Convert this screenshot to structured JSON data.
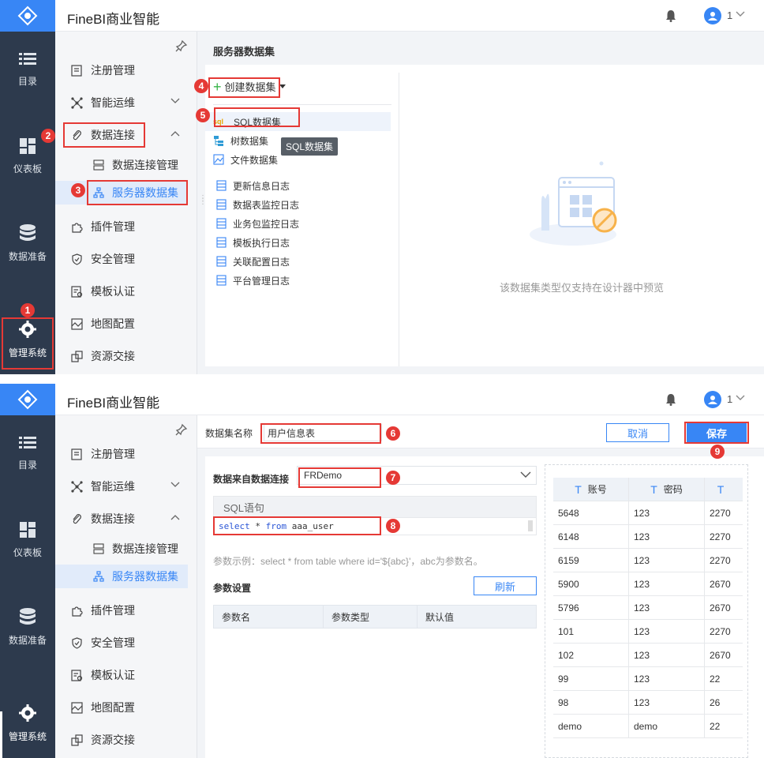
{
  "app": {
    "title": "FineBI商业智能",
    "user": "1"
  },
  "dark_nav": [
    {
      "label": "目录",
      "icon": "list-icon"
    },
    {
      "label": "仪表板",
      "icon": "dashboard-icon"
    },
    {
      "label": "数据准备",
      "icon": "database-icon"
    },
    {
      "label": "管理系统",
      "icon": "gear-icon"
    }
  ],
  "submenu": {
    "items": [
      {
        "label": "注册管理"
      },
      {
        "label": "智能运维"
      },
      {
        "label": "数据连接"
      },
      {
        "label": "数据连接管理"
      },
      {
        "label": "服务器数据集"
      },
      {
        "label": "插件管理"
      },
      {
        "label": "安全管理"
      },
      {
        "label": "模板认证"
      },
      {
        "label": "地图配置"
      },
      {
        "label": "资源交接"
      }
    ]
  },
  "panel1": {
    "title": "服务器数据集",
    "create_label": "创建数据集",
    "dropdown": [
      {
        "label": "SQL数据集",
        "icon": "sql"
      },
      {
        "label": "树数据集"
      },
      {
        "label": "文件数据集"
      }
    ],
    "tooltip": "SQL数据集",
    "logs": [
      "更新信息日志",
      "数据表监控日志",
      "业务包监控日志",
      "模板执行日志",
      "关联配置日志",
      "平台管理日志"
    ],
    "empty_text": "该数据集类型仅支持在设计器中预览"
  },
  "panel2": {
    "name_label": "数据集名称",
    "name_value": "用户信息表",
    "cancel": "取消",
    "save": "保存",
    "source_label": "数据来自数据连接",
    "source_value": "FRDemo",
    "sql_header": "SQL语句",
    "sql": {
      "kw1": "select",
      "mid": " * ",
      "kw2": "from",
      "rest": " aaa_user"
    },
    "param_hint": "参数示例：select * from table where id='${abc}'，abc为参数名。",
    "param_title": "参数设置",
    "refresh": "刷新",
    "param_cols": [
      "参数名",
      "参数类型",
      "默认值"
    ],
    "preview": {
      "type_glyph": "T",
      "columns": [
        "账号",
        "密码",
        ""
      ],
      "rows": [
        [
          "5648",
          "123",
          "2270"
        ],
        [
          "6148",
          "123",
          "2270"
        ],
        [
          "6159",
          "123",
          "2270"
        ],
        [
          "5900",
          "123",
          "2670"
        ],
        [
          "5796",
          "123",
          "2670"
        ],
        [
          "101",
          "123",
          "2270"
        ],
        [
          "102",
          "123",
          "2670"
        ],
        [
          "99",
          "123",
          "22"
        ],
        [
          "98",
          "123",
          "26"
        ],
        [
          "demo",
          "demo",
          "22"
        ]
      ]
    }
  },
  "callouts": [
    "1",
    "2",
    "3",
    "4",
    "5",
    "6",
    "7",
    "8",
    "9"
  ]
}
